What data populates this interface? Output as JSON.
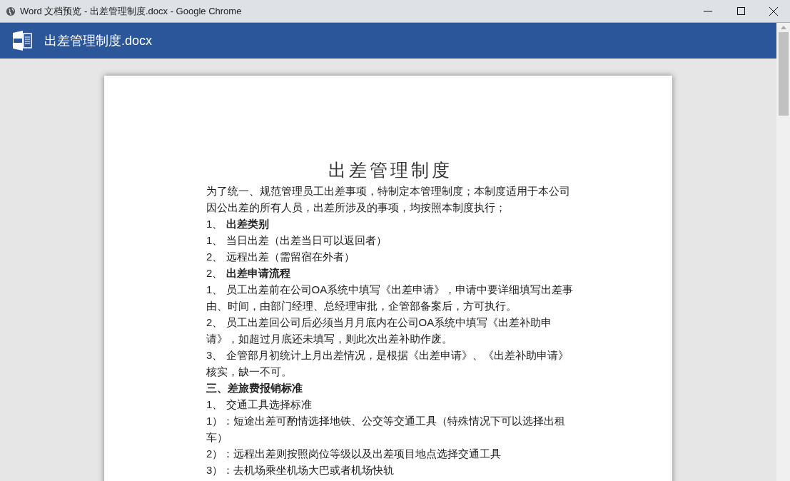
{
  "window": {
    "title": "Word 文档预览 - 出差管理制度.docx - Google Chrome"
  },
  "header": {
    "file_name": "出差管理制度.docx"
  },
  "document": {
    "title": "出差管理制度",
    "paragraphs": [
      {
        "text": "  为了统一、规范管理员工出差事项，特制定本管理制度；本制度适用于本公司因公出差的所有人员，出差所涉及的事项，均按照本制度执行；"
      },
      {
        "text": "1、 **出差类别**"
      },
      {
        "text": "1、 当日出差（出差当日可以返回者）"
      },
      {
        "text": "2、 远程出差（需留宿在外者）"
      },
      {
        "text": "2、 **出差申请流程**"
      },
      {
        "text": "1、 员工出差前在公司OA系统中填写《出差申请》，申请中要详细填写出差事由、时间，由部门经理、总经理审批，企管部备案后，方可执行。"
      },
      {
        "text": "2、 员工出差回公司后必须当月月底内在公司OA系统中填写《出差补助申请》，如超过月底还未填写，则此次出差补助作废。"
      },
      {
        "text": "3、 企管部月初统计上月出差情况，是根据《出差申请》、《出差补助申请》核实，缺一不可。"
      },
      {
        "text": "**三、差旅费报销标准**"
      },
      {
        "text": "1、 交通工具选择标准"
      },
      {
        "text": "1）：短途出差可酌情选择地铁、公交等交通工具（特殊情况下可以选择出租车）"
      },
      {
        "text": "2）：远程出差则按照岗位等级以及出差项目地点选择交通工具"
      },
      {
        "text": "3）：去机场乘坐机场大巴或者机场快轨"
      }
    ]
  }
}
